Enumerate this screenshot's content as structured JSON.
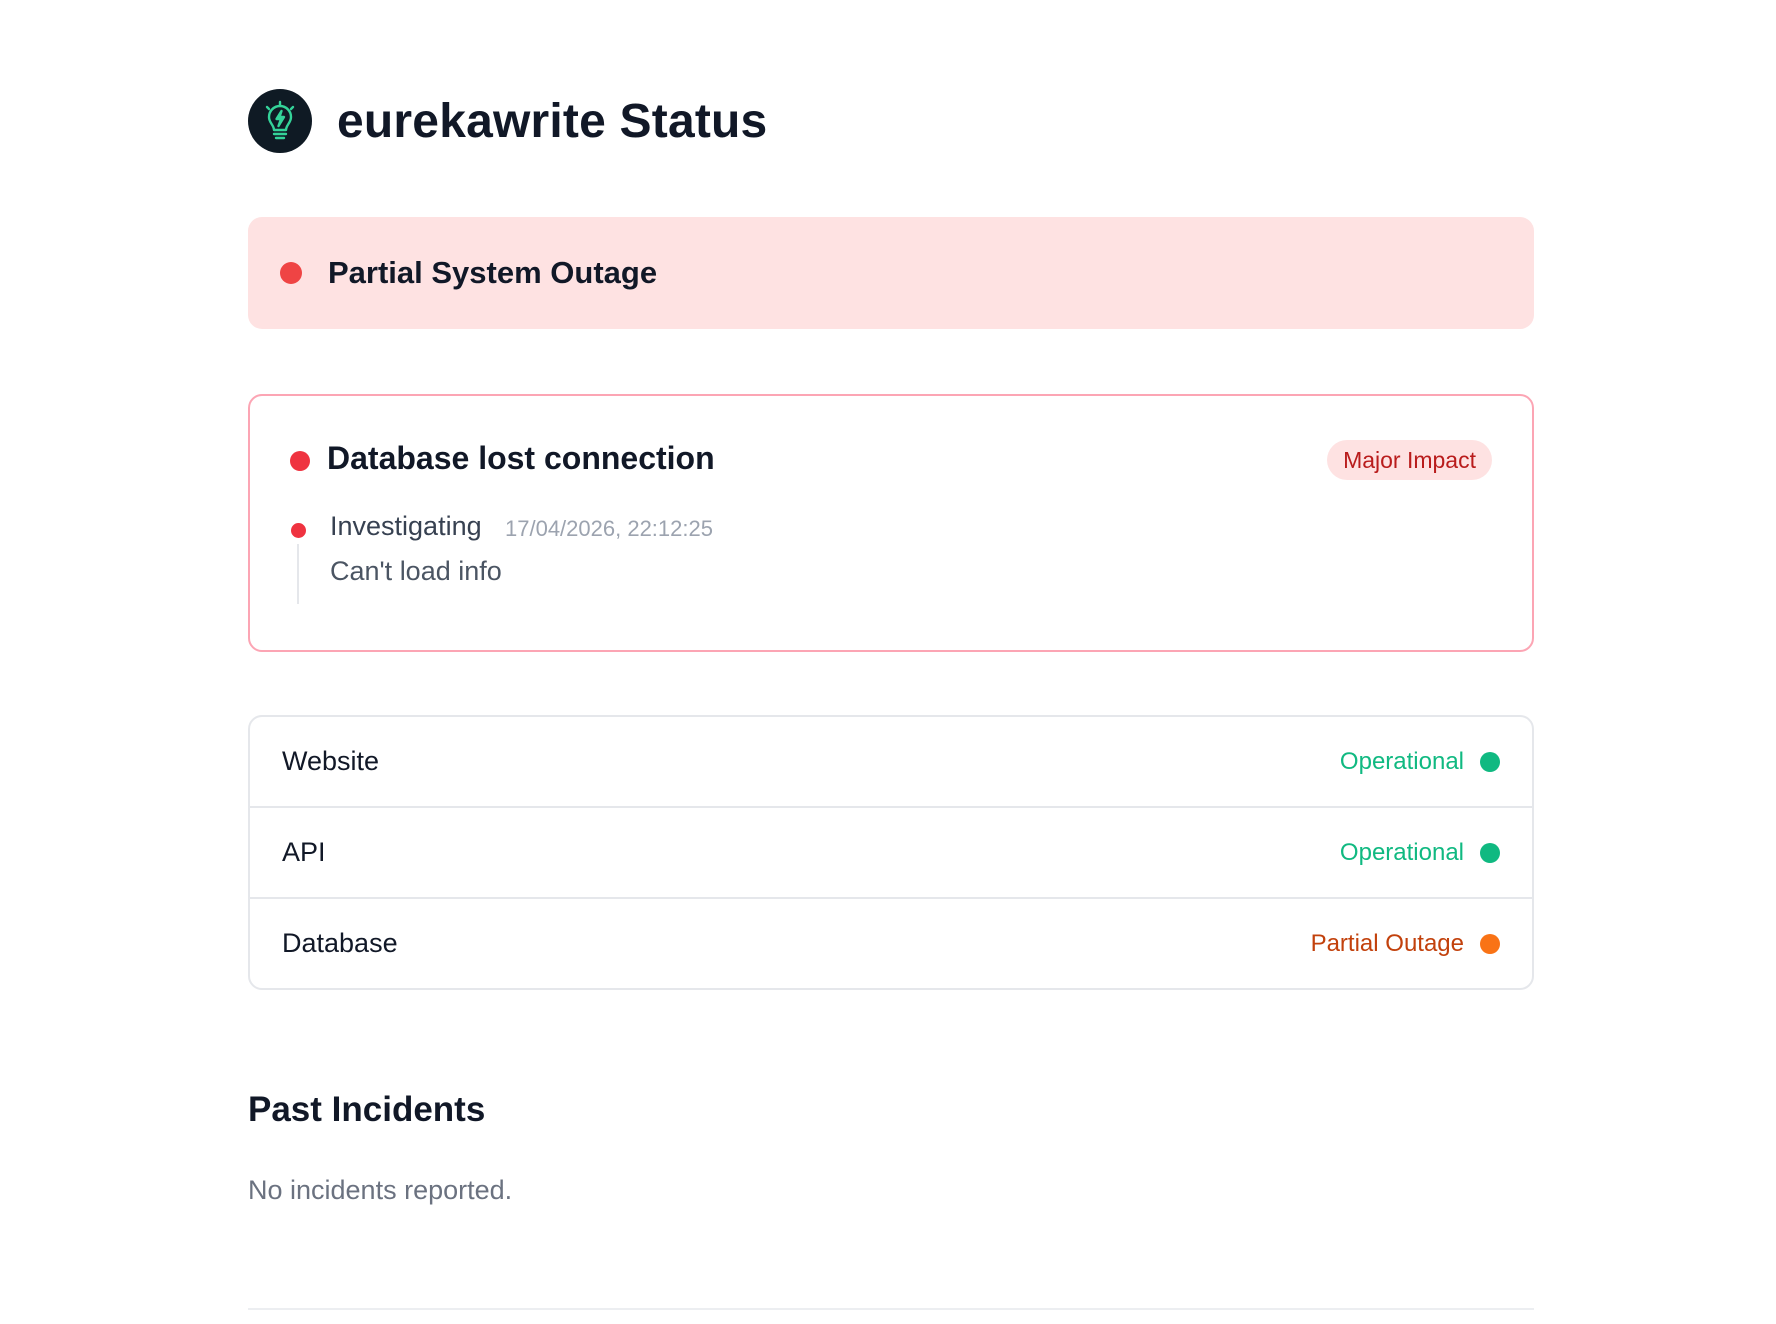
{
  "header": {
    "title": "eurekawrite Status",
    "logo_icon": "lightbulb-bolt-icon"
  },
  "overall_status": {
    "label": "Partial System Outage",
    "color": "#ef4444"
  },
  "active_incident": {
    "title": "Database lost connection",
    "impact": "Major Impact",
    "updates": [
      {
        "status": "Investigating",
        "timestamp": "17/04/2026, 22:12:25",
        "message": "Can't load info"
      }
    ]
  },
  "components": [
    {
      "name": "Website",
      "status": "Operational",
      "status_color": "#10b981",
      "dot_color": "#10b981"
    },
    {
      "name": "API",
      "status": "Operational",
      "status_color": "#10b981",
      "dot_color": "#10b981"
    },
    {
      "name": "Database",
      "status": "Partial Outage",
      "status_color": "#c2410c",
      "dot_color": "#f97316"
    }
  ],
  "past_incidents": {
    "title": "Past Incidents",
    "empty_message": "No incidents reported."
  }
}
